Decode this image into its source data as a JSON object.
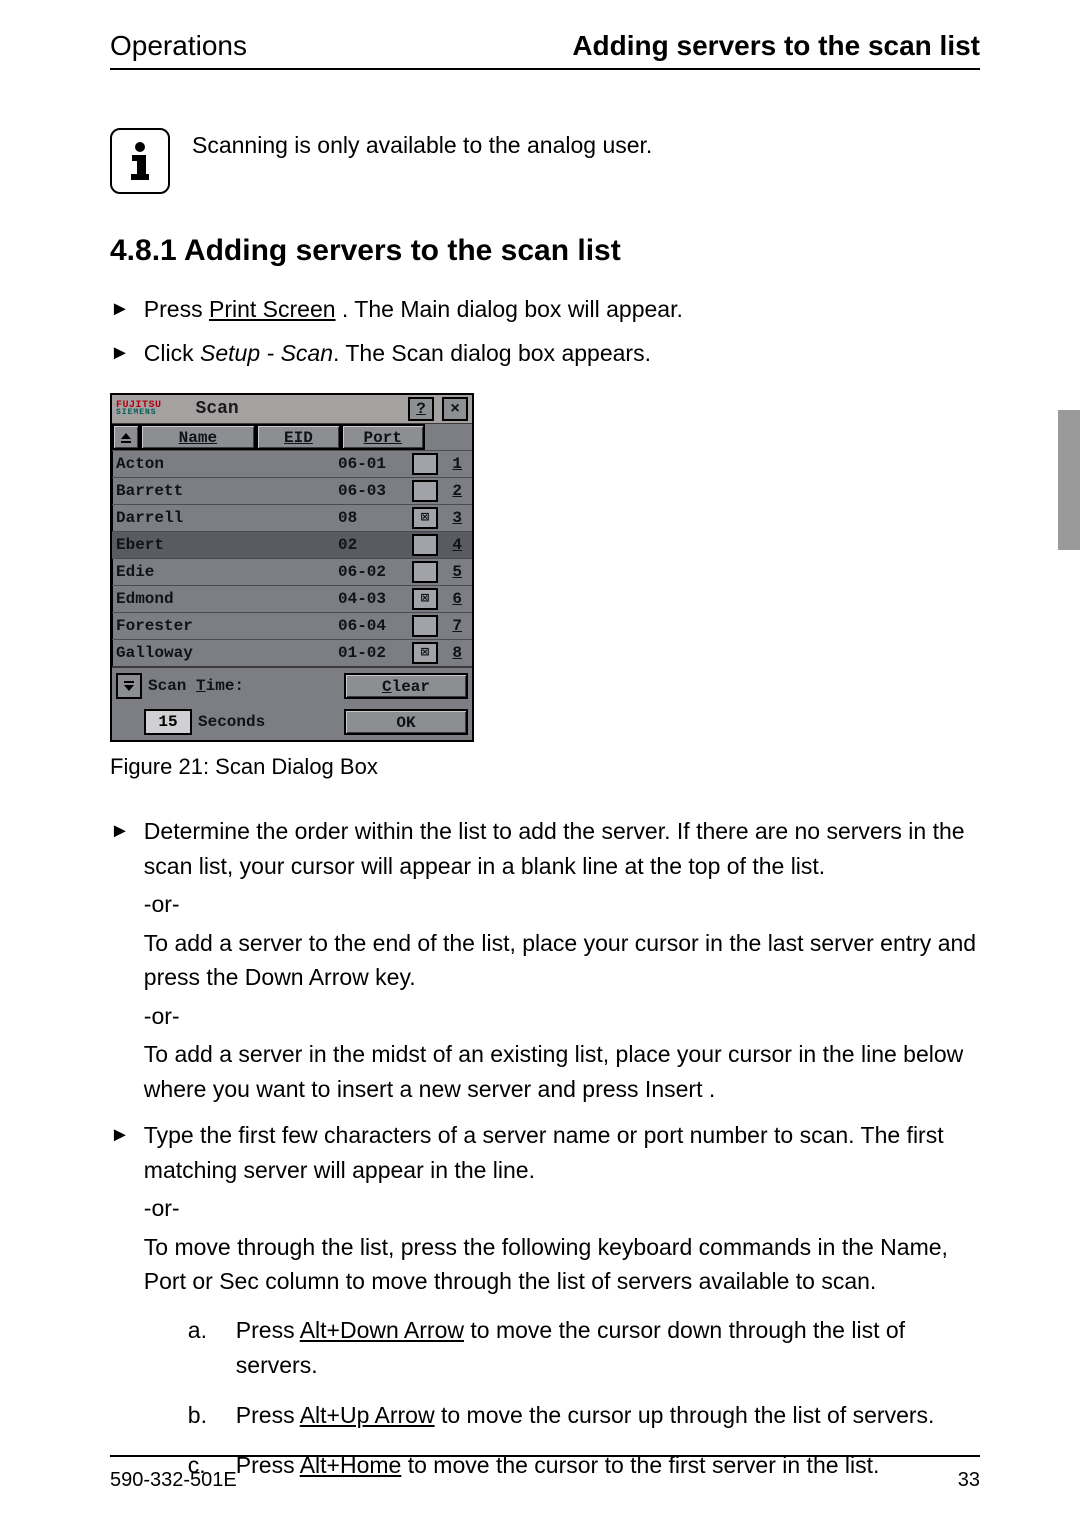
{
  "header": {
    "left": "Operations",
    "right": "Adding servers to the scan list"
  },
  "info_note": "Scanning is only available to the analog user.",
  "section": {
    "number_title": "4.8.1   Adding servers to the scan list"
  },
  "step_1": {
    "pre": "Press ",
    "underline": "Print Screen",
    "post": " . The Main dialog box will appear."
  },
  "step_2": {
    "pre": "Click ",
    "italic": "Setup - Scan",
    "post": ". The Scan dialog box appears."
  },
  "dialog": {
    "logo_top": "FUJITSU",
    "logo_bottom": "SIEMENS",
    "title": "Scan",
    "help_char": "?",
    "close_char": "×",
    "sort_up": "▲",
    "sort_down": "▼",
    "headers": {
      "name": "Name",
      "eid": "EID",
      "port": "Port"
    },
    "rows": [
      {
        "name": "Acton",
        "port": "06-01",
        "checked": false,
        "num": "1",
        "selected": false
      },
      {
        "name": "Barrett",
        "port": "06-03",
        "checked": false,
        "num": "2",
        "selected": false
      },
      {
        "name": "Darrell",
        "port": "08",
        "checked": true,
        "num": "3",
        "selected": false
      },
      {
        "name": "Ebert",
        "port": "02",
        "checked": false,
        "num": "4",
        "selected": true
      },
      {
        "name": "Edie",
        "port": "06-02",
        "checked": false,
        "num": "5",
        "selected": false
      },
      {
        "name": "Edmond",
        "port": "04-03",
        "checked": true,
        "num": "6",
        "selected": false
      },
      {
        "name": "Forester",
        "port": "06-04",
        "checked": false,
        "num": "7",
        "selected": false
      },
      {
        "name": "Galloway",
        "port": "01-02",
        "checked": true,
        "num": "8",
        "selected": false
      }
    ],
    "scan_time_label_pre": "Scan ",
    "scan_time_label_ul": "T",
    "scan_time_label_post": "ime:",
    "scan_time_value": "15",
    "seconds_label": "Seconds",
    "clear_ul": "C",
    "clear_rest": "lear",
    "ok_label": "OK",
    "check_mark": "⊠",
    "check_empty": "□"
  },
  "figcaption": "Figure 21: Scan Dialog Box",
  "step_3": {
    "p1": "Determine the order within the list to add the server. If there are no servers in the scan list, your cursor will appear in a blank line at the top of the list.",
    "or": "-or-",
    "p2": "To add a server to the end of the list, place your cursor in the last server entry and press the Down Arrow key.",
    "p3": "To add a server in the midst of an existing list, place your cursor in the line below where you want to insert a new server and press Insert ."
  },
  "step_4": {
    "p1": "Type the first few characters of a server name or port number to scan. The first matching server will appear in the line.",
    "or": "-or-",
    "p2": "To move through the list, press the following keyboard commands in the Name, Port or Sec column to move through the list of servers available to scan.",
    "sub": {
      "a": {
        "lbl": "a.",
        "pre": "Press ",
        "ul": "Alt+Down Arrow",
        "post": " to move the cursor down through the list of servers."
      },
      "b": {
        "lbl": "b.",
        "pre": "Press ",
        "ul": "Alt+Up Arrow",
        "post": " to move the cursor up through the list of servers."
      },
      "c": {
        "lbl": "c.",
        "pre": "Press ",
        "ul": "Alt+Home",
        "post": " to move the cursor to the first server in the list."
      }
    }
  },
  "footer": {
    "left": "590-332-501E",
    "right": "33"
  }
}
